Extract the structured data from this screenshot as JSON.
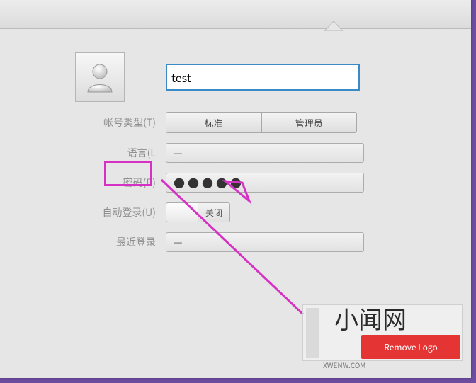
{
  "name_field": {
    "value": "test"
  },
  "rows": {
    "account_type": {
      "label": "帐号类型(T)",
      "standard": "标准",
      "admin": "管理员"
    },
    "language": {
      "label": "语言(L",
      "value": "—"
    },
    "password": {
      "label": "密码(P)",
      "masked": "●●●●●"
    },
    "autologin": {
      "label": "自动登录(U)",
      "state": "关闭"
    },
    "lastlogin": {
      "label": "最近登录",
      "value": "—"
    }
  },
  "watermark": {
    "title": "小闻网",
    "button": "Remove Logo",
    "footer": "XWENW.COM"
  }
}
